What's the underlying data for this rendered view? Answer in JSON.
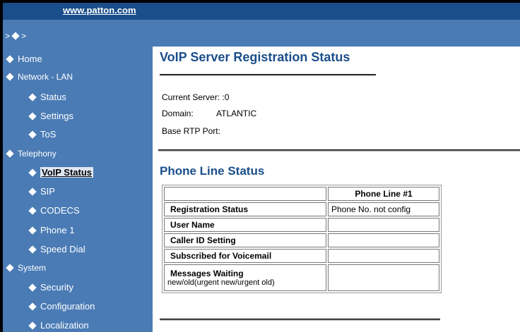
{
  "header": {
    "site_link": "www.patton.com"
  },
  "breadcrumb": {
    "separator": ">"
  },
  "sidebar": {
    "items": [
      {
        "label": "Home"
      },
      {
        "label": "Network - LAN"
      },
      {
        "label": "Status"
      },
      {
        "label": "Settings"
      },
      {
        "label": "ToS"
      },
      {
        "label": "Telephony"
      },
      {
        "label": "VoIP Status"
      },
      {
        "label": "SIP"
      },
      {
        "label": "CODECS"
      },
      {
        "label": "Phone 1"
      },
      {
        "label": "Speed Dial"
      },
      {
        "label": "System"
      },
      {
        "label": "Security"
      },
      {
        "label": "Configuration"
      },
      {
        "label": "Localization"
      }
    ]
  },
  "main": {
    "title": "VoIP Server Registration Status",
    "server": {
      "current_label": "Current Server:",
      "current_value": ":0",
      "domain_label": "Domain:",
      "domain_value": "ATLANTIC",
      "rtp_label": "Base RTP Port:"
    },
    "phone_status": {
      "heading": "Phone Line Status",
      "column_header": "Phone Line #1",
      "rows": [
        {
          "label": "Registration Status",
          "value": "Phone No. not config"
        },
        {
          "label": "User Name",
          "value": ""
        },
        {
          "label": "Caller ID Setting",
          "value": ""
        },
        {
          "label": "Subscribed for Voicemail",
          "value": ""
        },
        {
          "label": "Messages Waiting",
          "sublabel": "new/old(urgent new/urgent old)",
          "value": ""
        }
      ]
    }
  }
}
